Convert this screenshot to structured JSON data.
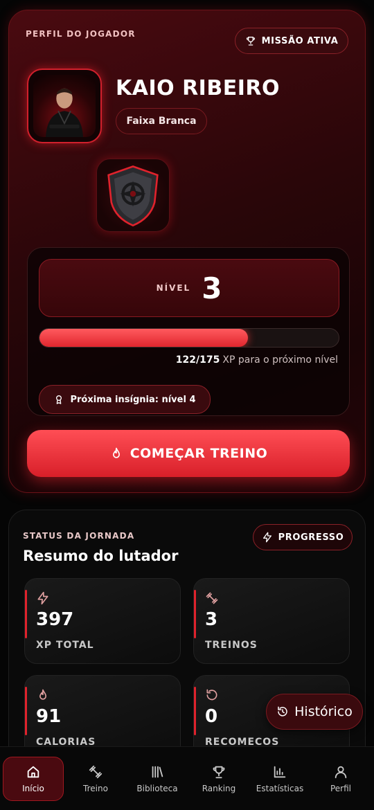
{
  "profile": {
    "eyebrow": "PERFIL DO JOGADOR",
    "mission_label": "MISSÃO ATIVA",
    "name": "KAIO RIBEIRO",
    "belt": "Faixa Branca"
  },
  "level": {
    "label": "NÍVEL",
    "value": "3",
    "xp_current": "122",
    "xp_sep": "/",
    "xp_max": "175",
    "xp_suffix": "XP para o próximo nível",
    "xp_progress_fraction": 0.697,
    "next_badge": "Próxima insígnia: nível 4"
  },
  "start_button": "COMEÇAR TREINO",
  "status": {
    "eyebrow": "STATUS DA JORNADA",
    "title": "Resumo do lutador",
    "progress_label": "PROGRESSO",
    "stats": [
      {
        "value": "397",
        "label": "XP TOTAL",
        "icon": "bolt-icon"
      },
      {
        "value": "3",
        "label": "TREINOS",
        "icon": "dumbbell-icon"
      },
      {
        "value": "91",
        "label": "CALORIAS",
        "icon": "flame-icon"
      },
      {
        "value": "0",
        "label": "RECOMECOS",
        "icon": "restart-icon"
      }
    ]
  },
  "history_button": "Histórico",
  "nav": [
    {
      "label": "Início",
      "icon": "home-icon",
      "active": true
    },
    {
      "label": "Treino",
      "icon": "dumbbell-icon"
    },
    {
      "label": "Biblioteca",
      "icon": "library-icon"
    },
    {
      "label": "Ranking",
      "icon": "trophy-icon"
    },
    {
      "label": "Estatísticas",
      "icon": "chart-icon"
    },
    {
      "label": "Perfil",
      "icon": "user-icon"
    }
  ],
  "colors": {
    "accent": "#e0222c",
    "background": "#050505",
    "card": "#2a0609"
  }
}
